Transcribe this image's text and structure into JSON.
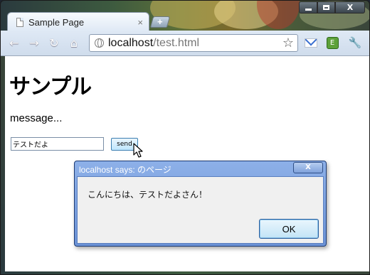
{
  "browser": {
    "tab": {
      "title": "Sample Page",
      "close_glyph": "×"
    },
    "new_tab_glyph": "+",
    "window_controls": {
      "close_glyph": "X"
    },
    "nav": {
      "back": "←",
      "forward": "→",
      "reload": "↻",
      "home": "⌂"
    },
    "address": {
      "host": "localhost",
      "path": "/test.html"
    },
    "star_glyph": "☆",
    "extensions": {
      "evernote_glyph": "E",
      "wrench_glyph": "🔧"
    }
  },
  "page": {
    "heading": "サンプル",
    "message": "message...",
    "input": {
      "value": "テストだよ"
    },
    "send_label": "send"
  },
  "dialog": {
    "title": "localhost says: のページ",
    "close_glyph": "X",
    "message": "こんにちは、テストだよさん！",
    "ok_label": "OK"
  },
  "icons": {
    "page": "page-icon",
    "globe": "globe-icon",
    "star": "star-icon",
    "gmail": "gmail-icon",
    "evernote": "evernote-icon",
    "wrench": "wrench-icon",
    "cursor": "mouse-pointer-icon"
  },
  "colors": {
    "dialog_frame": "#6b92d6",
    "button_gradient_top": "#eaf6fd",
    "button_gradient_bottom": "#bee6fd"
  }
}
